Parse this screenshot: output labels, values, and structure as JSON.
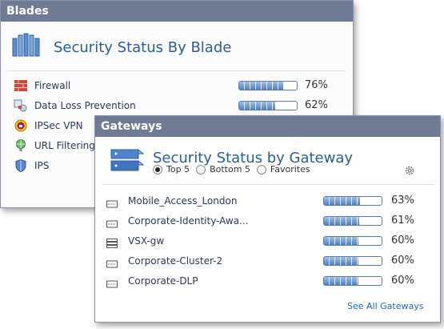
{
  "blades": {
    "header": "Blades",
    "title": "Security Status By Blade",
    "items": [
      {
        "label": "Firewall",
        "icon": "firewall-icon",
        "percent": 76,
        "percent_label": "76%"
      },
      {
        "label": "Data Loss Prevention",
        "icon": "data-loss-prevention-icon",
        "percent": 62,
        "percent_label": "62%"
      },
      {
        "label": "IPSec VPN",
        "icon": "vpn-lock-icon"
      },
      {
        "label": "URL Filtering",
        "icon": "url-filtering-icon"
      },
      {
        "label": "IPS",
        "icon": "ips-shield-icon"
      }
    ]
  },
  "gateways": {
    "header": "Gateways",
    "title": "Security Status by Gateway",
    "filters": [
      {
        "label": "Top 5",
        "selected": true
      },
      {
        "label": "Bottom 5",
        "selected": false
      },
      {
        "label": "Favorites",
        "selected": false
      }
    ],
    "items": [
      {
        "label": "Mobile_Access_London",
        "icon": "gateway-appliance-icon",
        "percent": 63,
        "percent_label": "63%"
      },
      {
        "label": "Corporate-Identity-Awa...",
        "icon": "gateway-appliance-icon",
        "percent": 61,
        "percent_label": "61%"
      },
      {
        "label": "VSX-gw",
        "icon": "vsx-gateway-icon",
        "percent": 60,
        "percent_label": "60%"
      },
      {
        "label": "Corporate-Cluster-2",
        "icon": "gateway-appliance-icon",
        "percent": 60,
        "percent_label": "60%"
      },
      {
        "label": "Corporate-DLP",
        "icon": "gateway-appliance-icon",
        "percent": 60,
        "percent_label": "60%"
      }
    ],
    "see_all_label": "See All Gateways"
  },
  "colors": {
    "header_bg": "#6f7b95",
    "title_text": "#2b5d96",
    "bar_fill": "#4f7ec6",
    "link": "#2b63b5"
  }
}
